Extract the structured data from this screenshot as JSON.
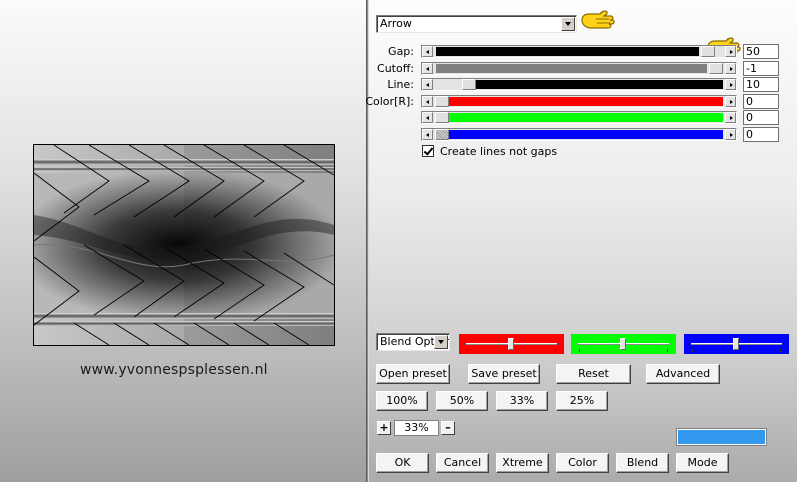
{
  "preview": {
    "watermark": "www.yvonnespsplessen.nl"
  },
  "pattern_dropdown": {
    "value": "Arrow"
  },
  "sliders": [
    {
      "label": "Gap:",
      "value": "50",
      "fill": 0.97,
      "color": "#000000"
    },
    {
      "label": "Cutoff:",
      "value": "-1",
      "fill": 1.0,
      "color": "#808080"
    },
    {
      "label": "Line:",
      "value": "10",
      "fill": 0.1,
      "color": "#000000"
    },
    {
      "label": "Color[R]:",
      "value": "0",
      "fill": 0.0,
      "color": "#ff0000"
    },
    {
      "label": "",
      "value": "0",
      "fill": 0.0,
      "color": "#00ff00"
    },
    {
      "label": "",
      "value": "0",
      "fill": 0.0,
      "color": "#0000ff"
    }
  ],
  "checkbox": {
    "label": "Create lines not gaps",
    "checked": true
  },
  "blend_dropdown": {
    "value": "Blend Options"
  },
  "color_sliders": [
    {
      "color": "#ff0000",
      "level": 0.5
    },
    {
      "color": "#00ff00",
      "level": 0.5
    },
    {
      "color": "#0000ff",
      "level": 0.5
    }
  ],
  "preset_buttons": {
    "open": "Open preset",
    "save": "Save preset",
    "reset": "Reset",
    "advanced": "Advanced"
  },
  "zoom_buttons": [
    "100%",
    "50%",
    "33%",
    "25%"
  ],
  "zoom": {
    "plus": "+",
    "minus": "–",
    "value": "33%"
  },
  "preview_color": "#3399ee",
  "bottom_buttons": {
    "ok": "OK",
    "cancel": "Cancel",
    "xtreme": "Xtreme",
    "color": "Color",
    "blend": "Blend",
    "mode": "Mode"
  },
  "colors": {
    "accent_hand": "#ffd21a",
    "hand_outline": "#8a6a00"
  },
  "icons": [
    "pointing-hand-icon",
    "chevron-down-icon",
    "arrow-left-icon",
    "arrow-right-icon",
    "check-icon"
  ]
}
